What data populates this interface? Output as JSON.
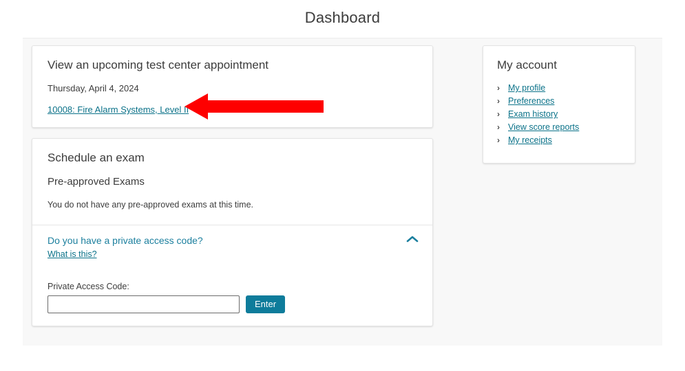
{
  "header": {
    "title": "Dashboard"
  },
  "appointment_card": {
    "heading": "View an upcoming test center appointment",
    "date": "Thursday, April 4, 2024",
    "exam_link": "10008: Fire Alarm Systems, Level II"
  },
  "schedule_card": {
    "heading": "Schedule an exam",
    "subheading": "Pre-approved Exams",
    "empty_note": "You do not have any pre-approved exams at this time.",
    "access_question": "Do you have a private access code?",
    "what_is_this": "What is this?",
    "field_label": "Private Access Code:",
    "code_value": "",
    "code_placeholder": "",
    "enter_label": "Enter",
    "toggle_icon": "chevron-up-icon"
  },
  "account_card": {
    "heading": "My account",
    "items": [
      {
        "label": "My profile",
        "bullet": "›"
      },
      {
        "label": "Preferences",
        "bullet": "›"
      },
      {
        "label": "Exam history",
        "bullet": "›"
      },
      {
        "label": "View score reports",
        "bullet": "›"
      },
      {
        "label": "My receipts",
        "bullet": "›"
      }
    ]
  },
  "annotation": {
    "type": "red-arrow-left",
    "color": "#fe0000",
    "points_to": "10008: Fire Alarm Systems, Level II"
  },
  "colors": {
    "link": "#0b7289",
    "accent_button": "#0e7c9b",
    "band_background": "#f8f8f8",
    "card_background": "#ffffff",
    "annotation_red": "#fe0000"
  }
}
